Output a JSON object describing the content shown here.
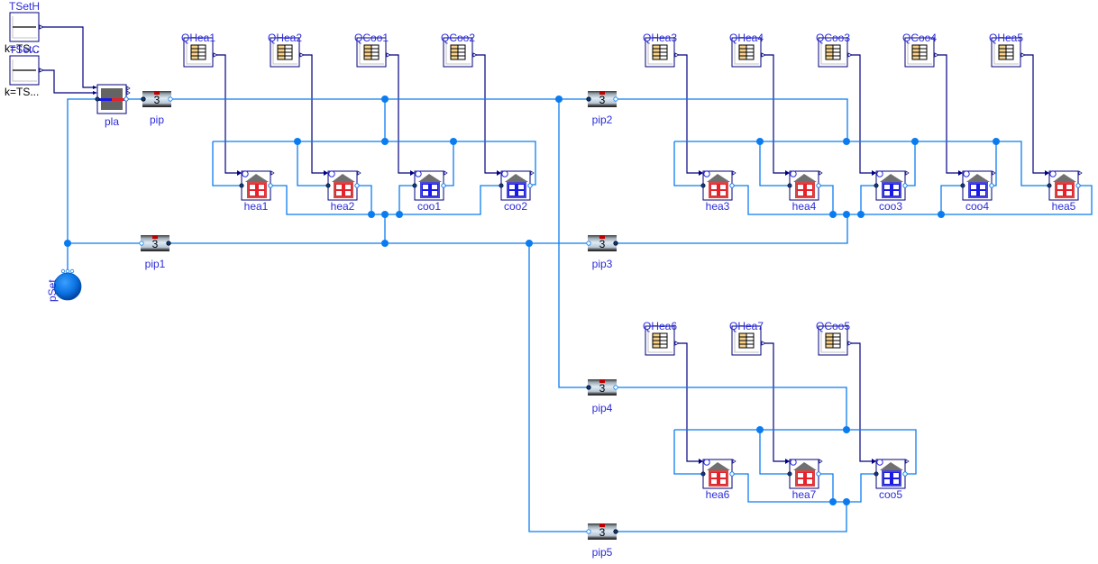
{
  "colors": {
    "fluid_wire": "#0a7cf0",
    "signal_wire": "#00007f",
    "label": "#2b2bdc",
    "heating": "#e8202a",
    "cooling": "#1a1ae8",
    "roof": "#707070",
    "table_fill": "#f6d28c"
  },
  "sources": [
    {
      "id": "TSetH",
      "label": "TSetH",
      "param": "k=TS..."
    },
    {
      "id": "TSetC",
      "label": "TSetC",
      "param": "k=TS..."
    }
  ],
  "plant": {
    "id": "pla",
    "label": "pla"
  },
  "pressure_source": {
    "id": "pSet",
    "label": "pSet"
  },
  "pipes": [
    {
      "id": "pip",
      "label": "pip",
      "segments": "3"
    },
    {
      "id": "pip1",
      "label": "pip1",
      "segments": "3"
    },
    {
      "id": "pip2",
      "label": "pip2",
      "segments": "3"
    },
    {
      "id": "pip3",
      "label": "pip3",
      "segments": "3"
    },
    {
      "id": "pip4",
      "label": "pip4",
      "segments": "3"
    },
    {
      "id": "pip5",
      "label": "pip5",
      "segments": "3"
    }
  ],
  "tables": [
    {
      "id": "QHea1",
      "label": "QHea1"
    },
    {
      "id": "QHea2",
      "label": "QHea2"
    },
    {
      "id": "QCoo1",
      "label": "QCoo1"
    },
    {
      "id": "QCoo2",
      "label": "QCoo2"
    },
    {
      "id": "QHea3",
      "label": "QHea3"
    },
    {
      "id": "QHea4",
      "label": "QHea4"
    },
    {
      "id": "QCoo3",
      "label": "QCoo3"
    },
    {
      "id": "QCoo4",
      "label": "QCoo4"
    },
    {
      "id": "QHea5",
      "label": "QHea5"
    },
    {
      "id": "QHea6",
      "label": "QHea6"
    },
    {
      "id": "QHea7",
      "label": "QHea7"
    },
    {
      "id": "QCoo5",
      "label": "QCoo5"
    }
  ],
  "loads": [
    {
      "id": "hea1",
      "label": "hea1",
      "kind": "heating"
    },
    {
      "id": "hea2",
      "label": "hea2",
      "kind": "heating"
    },
    {
      "id": "coo1",
      "label": "coo1",
      "kind": "cooling"
    },
    {
      "id": "coo2",
      "label": "coo2",
      "kind": "cooling"
    },
    {
      "id": "hea3",
      "label": "hea3",
      "kind": "heating"
    },
    {
      "id": "hea4",
      "label": "hea4",
      "kind": "heating"
    },
    {
      "id": "coo3",
      "label": "coo3",
      "kind": "cooling"
    },
    {
      "id": "coo4",
      "label": "coo4",
      "kind": "cooling"
    },
    {
      "id": "hea5",
      "label": "hea5",
      "kind": "heating"
    },
    {
      "id": "hea6",
      "label": "hea6",
      "kind": "heating"
    },
    {
      "id": "hea7",
      "label": "hea7",
      "kind": "heating"
    },
    {
      "id": "coo5",
      "label": "coo5",
      "kind": "cooling"
    }
  ]
}
